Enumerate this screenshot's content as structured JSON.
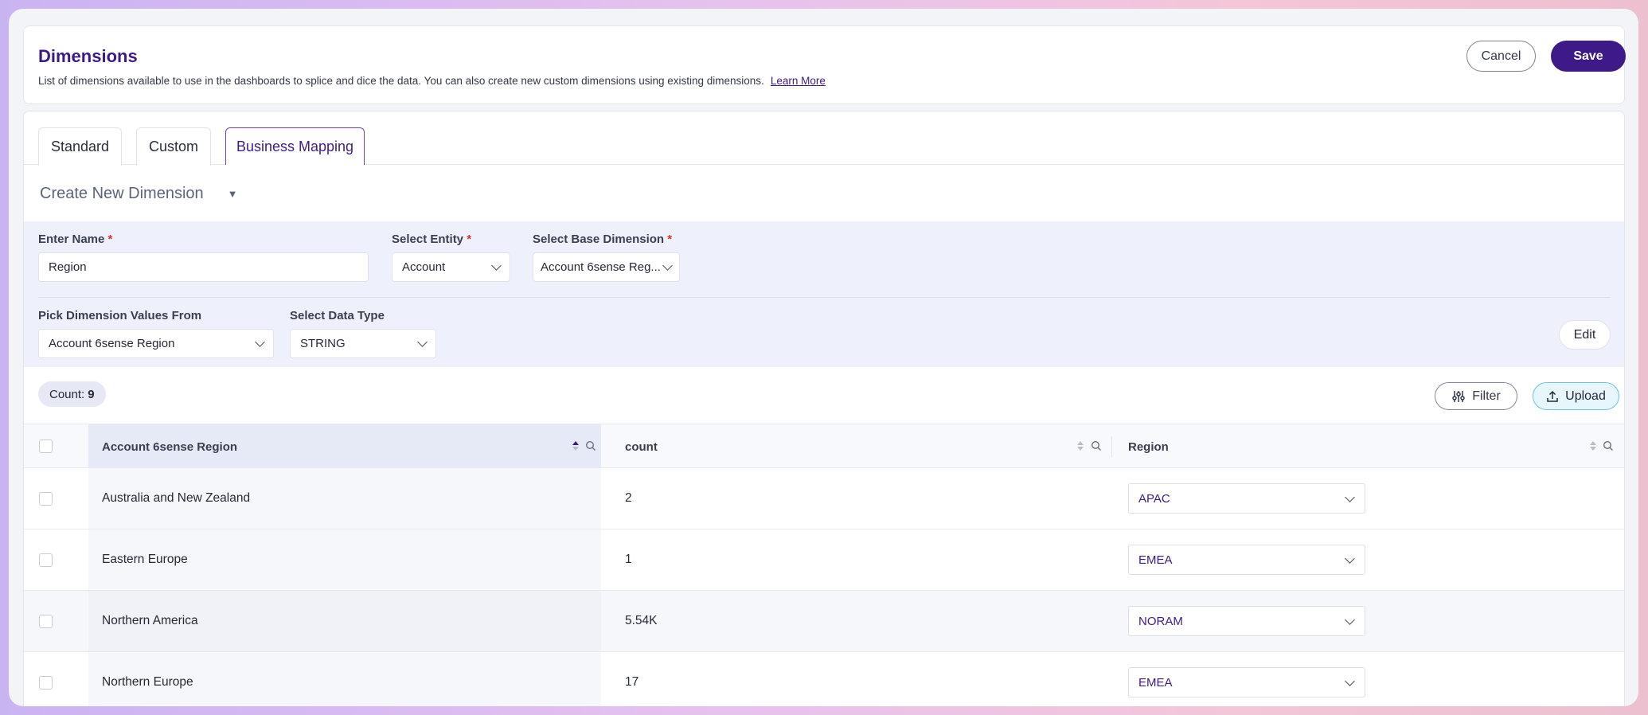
{
  "header": {
    "title": "Dimensions",
    "description": "List of dimensions available to use in the dashboards to splice and dice the data. You can also create new custom dimensions using existing dimensions.",
    "learn_more": "Learn More",
    "cancel_label": "Cancel",
    "save_label": "Save"
  },
  "tabs": [
    {
      "label": "Standard",
      "active": false
    },
    {
      "label": "Custom",
      "active": false
    },
    {
      "label": "Business Mapping",
      "active": true
    }
  ],
  "create": {
    "label": "Create New Dimension"
  },
  "form": {
    "name_label": "Enter Name",
    "name_value": "Region",
    "entity_label": "Select Entity",
    "entity_value": "Account",
    "base_label": "Select Base Dimension",
    "base_value": "Account 6sense Reg...",
    "values_from_label": "Pick Dimension Values From",
    "values_from_value": "Account 6sense Region",
    "data_type_label": "Select Data Type",
    "data_type_value": "STRING",
    "required_mark": "*",
    "edit_label": "Edit"
  },
  "toolbar": {
    "count_label": "Count:",
    "count_value": "9",
    "filter_label": "Filter",
    "upload_label": "Upload"
  },
  "table": {
    "columns": [
      "Account 6sense Region",
      "count",
      "Region"
    ],
    "rows": [
      {
        "name": "Australia and New Zealand",
        "count": "2",
        "region": "APAC"
      },
      {
        "name": "Eastern Europe",
        "count": "1",
        "region": "EMEA"
      },
      {
        "name": "Northern America",
        "count": "5.54K",
        "region": "NORAM"
      },
      {
        "name": "Northern Europe",
        "count": "17",
        "region": "EMEA"
      }
    ]
  },
  "colors": {
    "brand": "#3d1a87",
    "panel": "#eef0fb",
    "upload_accent": "#6cc6dd"
  }
}
